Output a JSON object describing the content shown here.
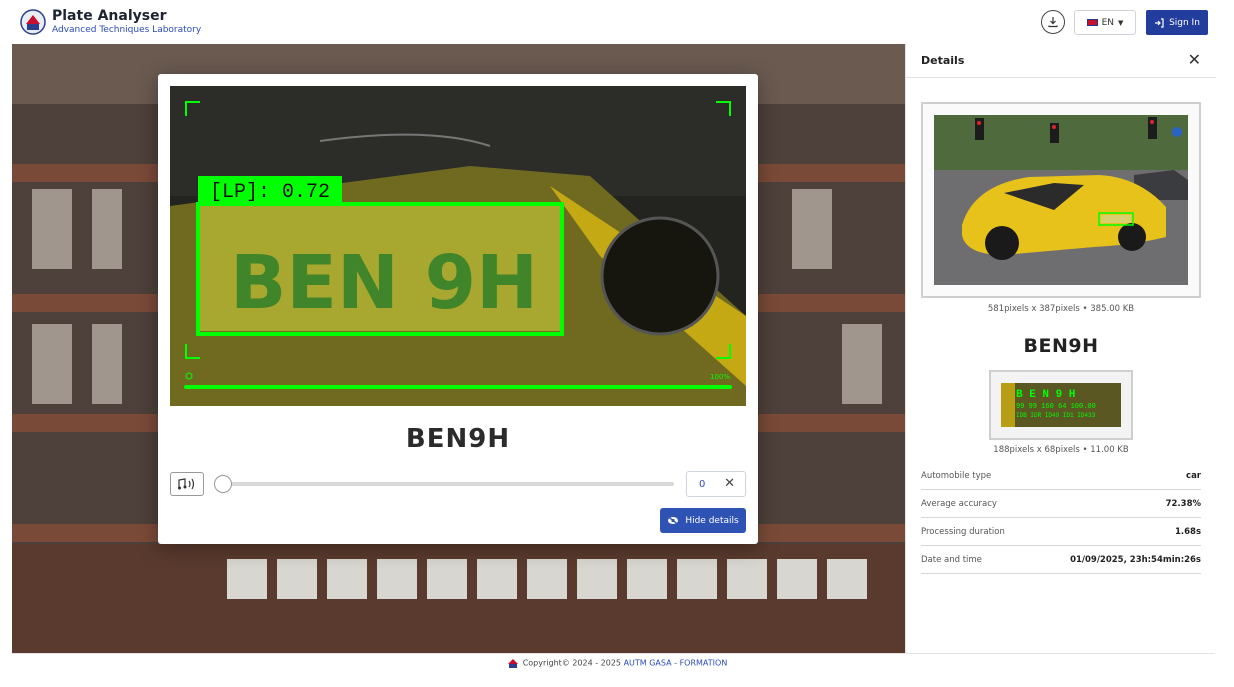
{
  "app": {
    "title": "Plate Analyser",
    "subtitle": "Advanced Techniques Laboratory"
  },
  "header": {
    "download_icon": "download-icon",
    "language": "EN",
    "sign_in_label": "Sign In"
  },
  "viewer": {
    "detection_label": "[LP]: 0.72",
    "plate_text_in_image": "BEN 9H",
    "progress_label": "100%",
    "progress": 1.0
  },
  "modal": {
    "plate_result": "BEN9H",
    "audio_position": "0",
    "hide_details_label": "Hide details"
  },
  "details": {
    "title": "Details",
    "image_meta": "581pixels x 387pixels • 385.00 KB",
    "plate_result": "BEN9H",
    "crop_meta": "188pixels x 68pixels • 11.00 KB",
    "crop_overlay": [
      "B E N 9 H",
      "99 99 160 64 100.00",
      "IDB IDR ID49 ID1 ID433"
    ],
    "rows": [
      {
        "label": "Automobile type",
        "value": "car"
      },
      {
        "label": "Average accuracy",
        "value": "72.38%"
      },
      {
        "label": "Processing duration",
        "value": "1.68s"
      },
      {
        "label": "Date and time",
        "value": "01/09/2025, 23h:54min:26s"
      }
    ]
  },
  "footer": {
    "copyright": "Copyright© 2024 - 2025 ",
    "org": "AUTM GASA - FORMATION"
  },
  "colors": {
    "accent": "#233d9c",
    "detection_green": "#00ff00",
    "car_yellow": "#e6c21a"
  }
}
